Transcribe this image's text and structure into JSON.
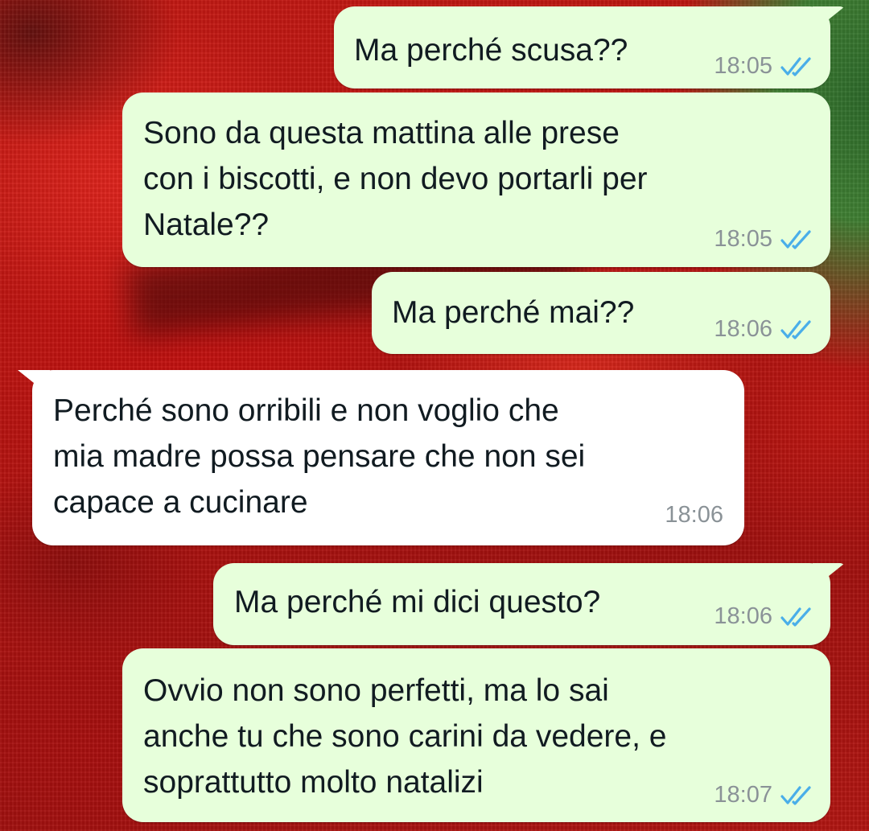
{
  "chat": {
    "colors": {
      "outgoing_bubble": "#e7ffdb",
      "incoming_bubble": "#ffffff",
      "read_ticks": "#4aaee9",
      "timestamp": "#8a9297"
    },
    "messages": [
      {
        "direction": "outgoing",
        "text": "Ma perché scusa??",
        "time": "18:05",
        "status": "read",
        "status_icon": "double-check-blue-icon"
      },
      {
        "direction": "outgoing",
        "text": "Sono da questa mattina alle prese\ncon i biscotti, e non devo portarli per\nNatale??",
        "time": "18:05",
        "status": "read",
        "status_icon": "double-check-blue-icon"
      },
      {
        "direction": "outgoing",
        "text": "Ma perché mai??",
        "time": "18:06",
        "status": "read",
        "status_icon": "double-check-blue-icon"
      },
      {
        "direction": "incoming",
        "text": "Perché sono orribili e non voglio che\nmia madre possa pensare che non sei\ncapace a cucinare",
        "time": "18:06"
      },
      {
        "direction": "outgoing",
        "text": "Ma perché mi dici questo?",
        "time": "18:06",
        "status": "read",
        "status_icon": "double-check-blue-icon"
      },
      {
        "direction": "outgoing",
        "text": "Ovvio non sono perfetti, ma lo sai\nanche tu che sono carini da vedere, e\nsoprattutto molto natalizi",
        "time": "18:07",
        "status": "read",
        "status_icon": "double-check-blue-icon"
      }
    ]
  }
}
